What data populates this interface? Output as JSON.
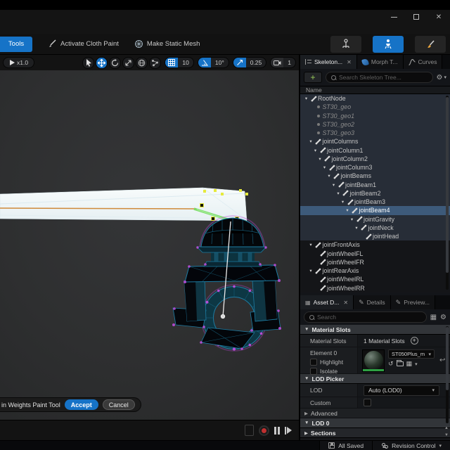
{
  "colors": {
    "accent_blue": "#1673c7",
    "selection_blue": "#3d5a7a",
    "wireframe_teal": "#1d7ca3",
    "vertex_magenta": "#c44fe2",
    "weight_green": "#74dc5e",
    "beam_orange": "#cf8a3a",
    "vertex_yellow": "#e6ea3c"
  },
  "toolbar": {
    "tools_label": "Tools",
    "activate_cloth_paint": "Activate Cloth Paint",
    "make_static_mesh": "Make Static Mesh"
  },
  "viewport": {
    "playback_speed": "x1.0",
    "grid_snap": "10",
    "angle_snap": "10°",
    "scale_snap": "0.25",
    "camera_speed": "1",
    "paint_overlay": {
      "label": "in Weights Paint Tool",
      "accept": "Accept",
      "cancel": "Cancel"
    }
  },
  "skeleton_panel": {
    "tabs": [
      {
        "label": "Skeleton..."
      },
      {
        "label": "Morph T..."
      },
      {
        "label": "Curves"
      }
    ],
    "add_label": "+",
    "search_placeholder": "Search Skeleton Tree...",
    "column_header": "Name",
    "tree": [
      {
        "label": "RootNode",
        "level": 0,
        "icon": "bone",
        "expand": true,
        "zone": true
      },
      {
        "label": "ST30_geo",
        "level": 1,
        "icon": "dot",
        "italic": true,
        "zone": true
      },
      {
        "label": "ST30_geo1",
        "level": 1,
        "icon": "dot",
        "italic": true,
        "zone": true
      },
      {
        "label": "ST30_geo2",
        "level": 1,
        "icon": "dot",
        "italic": true,
        "zone": true
      },
      {
        "label": "ST30_geo3",
        "level": 1,
        "icon": "dot",
        "italic": true,
        "zone": true
      },
      {
        "label": "jointColumns",
        "level": 1,
        "icon": "bone",
        "expand": true,
        "zone": true
      },
      {
        "label": "jointColumn1",
        "level": 2,
        "icon": "bone",
        "expand": true,
        "zone": true
      },
      {
        "label": "jointColumn2",
        "level": 3,
        "icon": "bone",
        "expand": true,
        "zone": true
      },
      {
        "label": "jointColumn3",
        "level": 4,
        "icon": "bone",
        "expand": true,
        "zone": true
      },
      {
        "label": "jointBeams",
        "level": 5,
        "icon": "bone",
        "expand": true,
        "zone": true
      },
      {
        "label": "jointBeam1",
        "level": 6,
        "icon": "bone",
        "expand": true,
        "zone": true
      },
      {
        "label": "jointBeam2",
        "level": 7,
        "icon": "bone",
        "expand": true,
        "zone": true
      },
      {
        "label": "jointBeam3",
        "level": 8,
        "icon": "bone",
        "expand": true,
        "zone": true
      },
      {
        "label": "jointBeam4",
        "level": 9,
        "icon": "bone",
        "expand": true,
        "zone": true,
        "selected": true
      },
      {
        "label": "jointGravity",
        "level": 10,
        "icon": "bone",
        "expand": true,
        "zone": true
      },
      {
        "label": "jointNeck",
        "level": 11,
        "icon": "bone",
        "expand": true,
        "zone": true
      },
      {
        "label": "jointHead",
        "level": 12,
        "icon": "bone",
        "zone": true
      },
      {
        "label": "jointFrontAxis",
        "level": 1,
        "icon": "bone",
        "expand": true
      },
      {
        "label": "jointWheelFL",
        "level": 2,
        "icon": "bone"
      },
      {
        "label": "jointWheelFR",
        "level": 2,
        "icon": "bone"
      },
      {
        "label": "jointRearAxis",
        "level": 1,
        "icon": "bone",
        "expand": true
      },
      {
        "label": "jointWheelRL",
        "level": 2,
        "icon": "bone"
      },
      {
        "label": "jointWheelRR",
        "level": 2,
        "icon": "bone"
      }
    ]
  },
  "details_panel": {
    "tabs": [
      {
        "label": "Asset D..."
      },
      {
        "label": "Details"
      },
      {
        "label": "Preview..."
      }
    ],
    "search_placeholder": "Search",
    "material_slots": {
      "header": "Material Slots",
      "label": "Material Slots",
      "count": "1 Material Slots",
      "element_label": "Element 0",
      "highlight": "Highlight",
      "isolate": "Isolate",
      "material_name": "ST050Plus_m"
    },
    "lod_picker": {
      "header": "LOD Picker",
      "lod_label": "LOD",
      "lod_value": "Auto (LOD0)",
      "custom_label": "Custom",
      "advanced_label": "Advanced"
    },
    "lod0_header": "LOD 0",
    "sections_header": "Sections"
  },
  "status_bar": {
    "all_saved": "All Saved",
    "revision_control": "Revision Control"
  }
}
